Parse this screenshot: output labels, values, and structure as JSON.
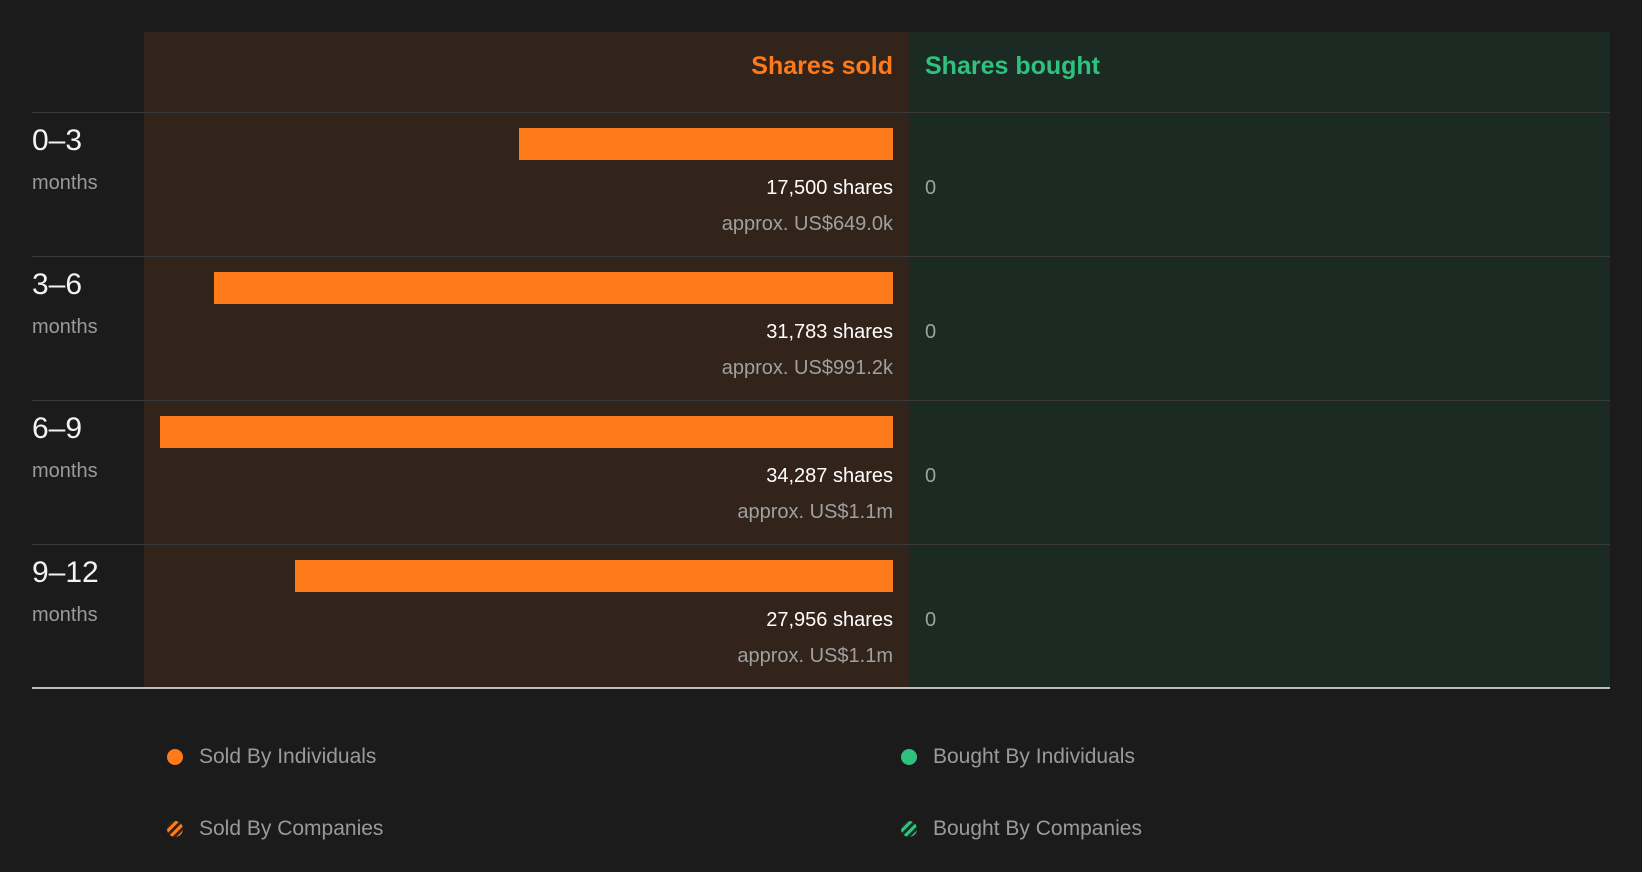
{
  "headers": {
    "sold": "Shares sold",
    "bought": "Shares bought"
  },
  "colors": {
    "sold": "#ff7a1a",
    "bought": "#2ec27e"
  },
  "rows": [
    {
      "range": "0–3",
      "unit": "months",
      "shares_label": "17,500 shares",
      "value_label": "approx. US$649.0k",
      "bought_label": "0"
    },
    {
      "range": "3–6",
      "unit": "months",
      "shares_label": "31,783 shares",
      "value_label": "approx. US$991.2k",
      "bought_label": "0"
    },
    {
      "range": "6–9",
      "unit": "months",
      "shares_label": "34,287 shares",
      "value_label": "approx. US$1.1m",
      "bought_label": "0"
    },
    {
      "range": "9–12",
      "unit": "months",
      "shares_label": "27,956 shares",
      "value_label": "approx. US$1.1m",
      "bought_label": "0"
    }
  ],
  "legend": {
    "sold_individuals": "Sold By Individuals",
    "bought_individuals": "Bought By Individuals",
    "sold_companies": "Sold By Companies",
    "bought_companies": "Bought By Companies"
  },
  "chart_data": {
    "type": "bar",
    "categories": [
      "0–3",
      "3–6",
      "6–9",
      "9–12"
    ],
    "series": [
      {
        "name": "Shares sold",
        "values": [
          17500,
          31783,
          34287,
          27956
        ]
      },
      {
        "name": "Shares bought",
        "values": [
          0,
          0,
          0,
          0
        ]
      }
    ],
    "xlabel": "months",
    "ylabel": "",
    "ylim": [
      0,
      34287
    ],
    "grid": false,
    "legend_position": "bottom"
  }
}
